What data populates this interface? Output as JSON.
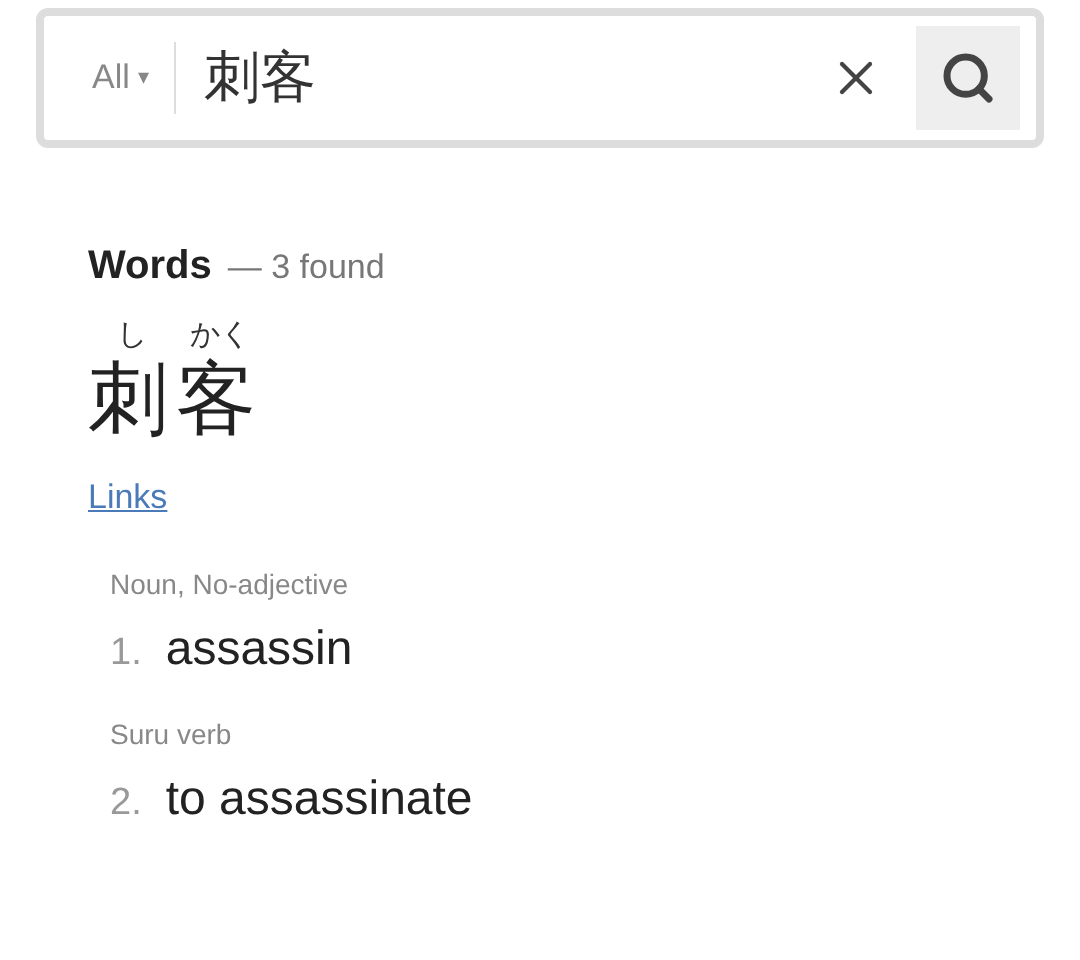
{
  "search": {
    "scope": "All",
    "scope_caret": "▾",
    "value": "刺客"
  },
  "results": {
    "heading": "Words",
    "count": "— 3 found",
    "entry": {
      "furigana": [
        "し",
        "かく"
      ],
      "word": "刺客",
      "link": "Links",
      "senses": [
        {
          "tag": "Noun, No-adjective",
          "number": "1.",
          "meaning": "assassin"
        },
        {
          "tag": "Suru verb",
          "number": "2.",
          "meaning": "to assassinate"
        }
      ]
    }
  }
}
